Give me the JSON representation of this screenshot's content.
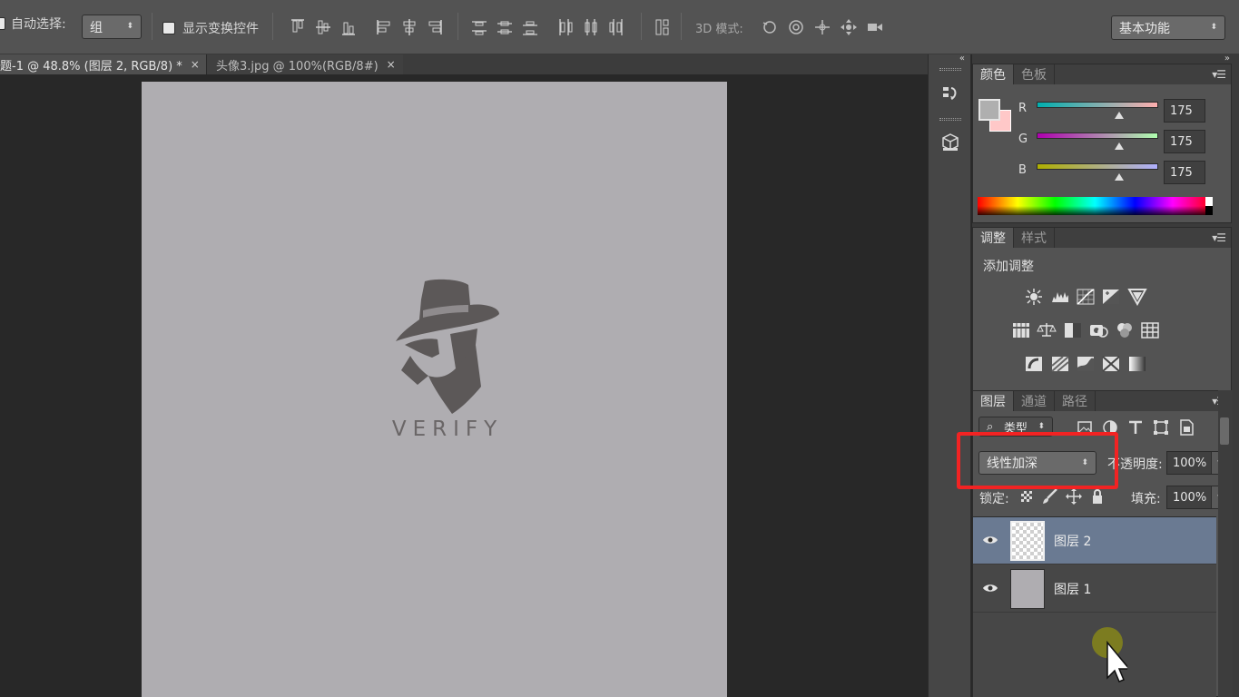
{
  "options_bar": {
    "auto_select_label": "自动选择:",
    "auto_select_value": "组",
    "show_transform_label": "显示变换控件",
    "mode_3d_label": "3D 模式:",
    "workspace_value": "基本功能"
  },
  "tabs": [
    {
      "label": "题-1 @ 48.8% (图层 2, RGB/8) *",
      "close": "×"
    },
    {
      "label": "头像3.jpg @ 100%(RGB/8#)",
      "close": "×"
    }
  ],
  "document": {
    "logo_text": "VERIFY",
    "background_color": "#afadb1"
  },
  "color_panel": {
    "tabs": [
      "颜色",
      "色板"
    ],
    "channels": [
      {
        "label": "R",
        "value": "175"
      },
      {
        "label": "G",
        "value": "175"
      },
      {
        "label": "B",
        "value": "175"
      }
    ],
    "foreground_color": "#afafaf",
    "background_color": "#ffc8c8"
  },
  "adjust_panel": {
    "tabs": [
      "调整",
      "样式"
    ],
    "title": "添加调整"
  },
  "layers_panel": {
    "tabs": [
      "图层",
      "通道",
      "路径"
    ],
    "filter_kind": "类型",
    "blend_mode": "线性加深",
    "opacity_label": "不透明度:",
    "opacity_value": "100%",
    "lock_label": "锁定:",
    "fill_label": "填充:",
    "fill_value": "100%",
    "layers": [
      {
        "name": "图层 2",
        "selected": true
      },
      {
        "name": "图层 1",
        "selected": false
      }
    ]
  },
  "colors": {
    "highlight": "#f22323",
    "selected_layer": "#6a7a92"
  }
}
